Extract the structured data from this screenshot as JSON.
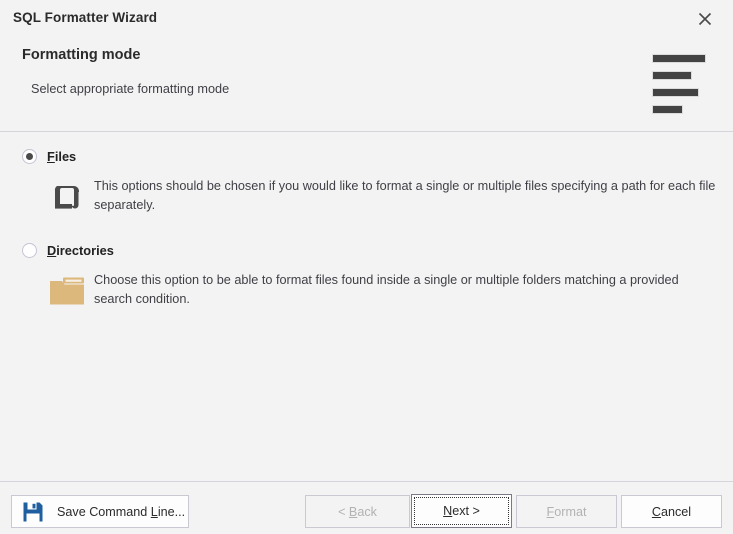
{
  "window": {
    "title": "SQL Formatter Wizard",
    "close_icon": "close-icon"
  },
  "header": {
    "title": "Formatting mode",
    "subtitle": "Select appropriate formatting mode",
    "logo_icon": "formatter-bars-logo"
  },
  "options": [
    {
      "id": "files",
      "label_accel": "F",
      "label_rest": "iles",
      "selected": true,
      "icon": "scroll-document-icon",
      "description": "This options should be chosen if you would like to format a single or multiple files specifying a path for each file separately."
    },
    {
      "id": "directories",
      "label_accel": "D",
      "label_rest": "irectories",
      "selected": false,
      "icon": "folder-icon",
      "description": "Choose this option to be able to format files found inside a single or multiple folders matching a provided search condition."
    }
  ],
  "footer": {
    "save_icon": "floppy-disk-icon",
    "save_pre": "Save Command ",
    "save_accel": "L",
    "save_post": "ine...",
    "back_pre": "< ",
    "back_accel": "B",
    "back_post": "ack",
    "next_accel": "N",
    "next_post": "ext >",
    "format_accel": "F",
    "format_post": "ormat",
    "cancel_accel": "C",
    "cancel_post": "ancel"
  },
  "colors": {
    "background": "#f3f3f3",
    "folder": "#ddb87d",
    "scroll_icon": "#4a4a4a",
    "floppy": "#1f5fa0",
    "divider": "#d4d4dd",
    "disabled_text": "#b2b2b2"
  }
}
